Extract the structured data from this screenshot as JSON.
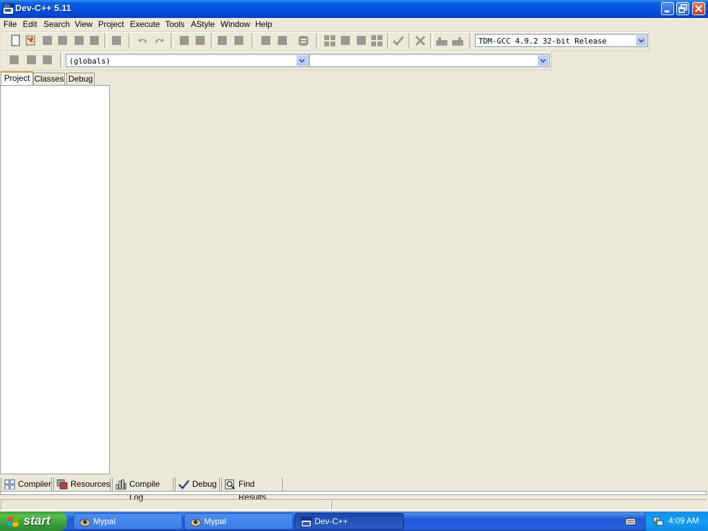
{
  "window": {
    "title": "Dev-C++ 5.11",
    "app_icon_text": "DEV"
  },
  "menu": [
    "File",
    "Edit",
    "Search",
    "View",
    "Project",
    "Execute",
    "Tools",
    "AStyle",
    "Window",
    "Help"
  ],
  "toolbar": {
    "compiler_select": "TDM-GCC 4.9.2 32-bit Release",
    "scope_select": "(globals)",
    "symbol_select": ""
  },
  "left_tabs": [
    "Project",
    "Classes",
    "Debug"
  ],
  "bottom_tabs": [
    "Compiler",
    "Resources",
    "Compile Log",
    "Debug",
    "Find Results"
  ],
  "taskbar": {
    "start_label": "start",
    "tasks": [
      "Mypal",
      "Mypal",
      "Dev-C++"
    ],
    "clock": "4:09 AM"
  },
  "colors": {
    "window_face": "#ECE9D8",
    "titlebar": "#0054E3",
    "taskbar": "#245EDC",
    "start_green": "#3C9E3C",
    "tray": "#0F8FF0"
  }
}
